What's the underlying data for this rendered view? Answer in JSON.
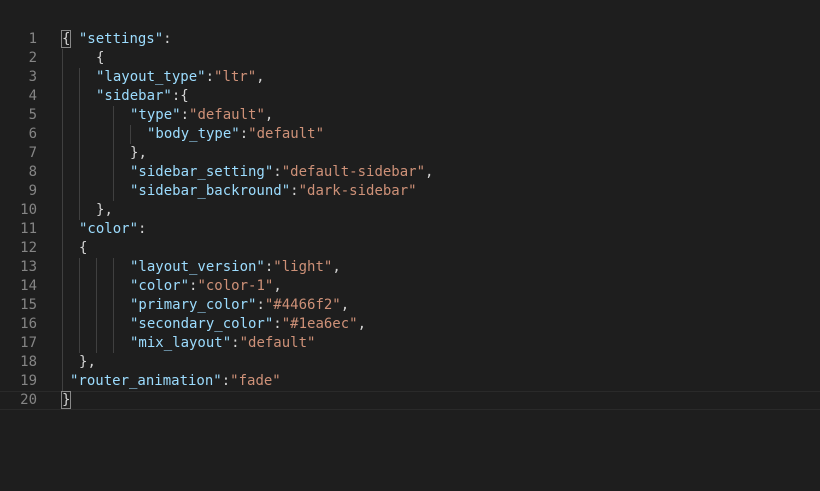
{
  "editor": {
    "language": "json",
    "colors": {
      "background": "#1e1e1e",
      "line_number": "#858585",
      "key": "#9cdcfe",
      "string": "#ce9178",
      "punctuation": "#d4d4d4"
    },
    "lines": [
      {
        "number": "1",
        "text": "{ \"settings\":"
      },
      {
        "number": "2",
        "text": "{"
      },
      {
        "number": "3",
        "text": "\"layout_type\":\"ltr\","
      },
      {
        "number": "4",
        "text": "\"sidebar\":{"
      },
      {
        "number": "5",
        "text": "\"type\":\"default\","
      },
      {
        "number": "6",
        "text": "\"body_type\":\"default\""
      },
      {
        "number": "7",
        "text": "},"
      },
      {
        "number": "8",
        "text": "\"sidebar_setting\":\"default-sidebar\","
      },
      {
        "number": "9",
        "text": "\"sidebar_backround\":\"dark-sidebar\""
      },
      {
        "number": "10",
        "text": "},"
      },
      {
        "number": "11",
        "text": "\"color\":"
      },
      {
        "number": "12",
        "text": "{"
      },
      {
        "number": "13",
        "text": "\"layout_version\":\"light\","
      },
      {
        "number": "14",
        "text": "\"color\":\"color-1\","
      },
      {
        "number": "15",
        "text": "\"primary_color\":\"#4466f2\","
      },
      {
        "number": "16",
        "text": "\"secondary_color\":\"#1ea6ec\","
      },
      {
        "number": "17",
        "text": "\"mix_layout\":\"default\""
      },
      {
        "number": "18",
        "text": "},"
      },
      {
        "number": "19",
        "text": "\"router_animation\":\"fade\""
      },
      {
        "number": "20",
        "text": "}"
      }
    ],
    "current_line": "20"
  }
}
